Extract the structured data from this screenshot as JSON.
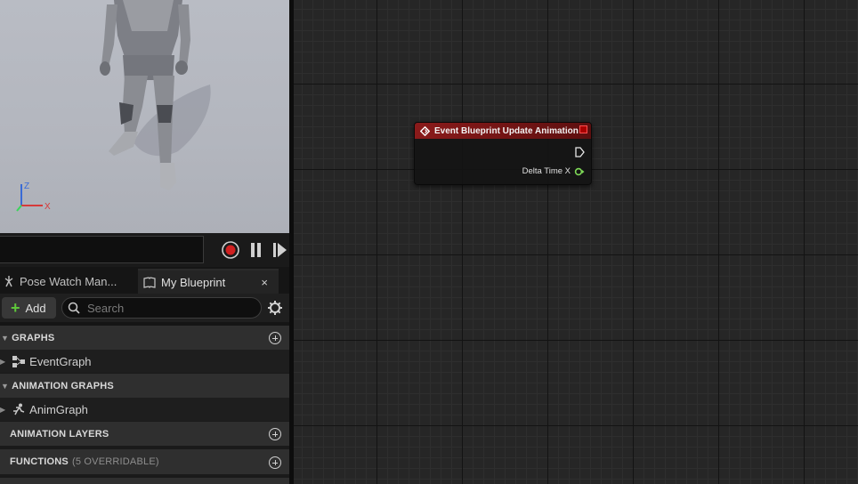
{
  "playback": {
    "record_label": "record",
    "pause_label": "pause",
    "step_label": "step"
  },
  "tabs": [
    {
      "label": "Pose Watch Man...",
      "icon": "pose-watch-icon"
    },
    {
      "label": "My Blueprint",
      "icon": "blueprint-book-icon",
      "close": "×"
    }
  ],
  "toolbar": {
    "add_label": "Add",
    "search_placeholder": "Search"
  },
  "sections": {
    "graphs": {
      "label": "GRAPHS"
    },
    "animation_graphs": {
      "label": "ANIMATION GRAPHS"
    },
    "animation_layers": {
      "label": "ANIMATION LAYERS"
    },
    "functions": {
      "label": "FUNCTIONS",
      "sub": "(5 OVERRIDABLE)"
    }
  },
  "items": {
    "event_graph": {
      "label": "EventGraph",
      "icon": "event-graph-icon"
    },
    "anim_graph": {
      "label": "AnimGraph",
      "icon": "anim-graph-icon"
    }
  },
  "viewport": {
    "axis": {
      "z": "Z",
      "x": "X"
    }
  },
  "node": {
    "title": "Event Blueprint Update Animation",
    "output_pin": "Delta Time X",
    "header_color": "#8a1a1a",
    "pin_color": "#7ed957"
  }
}
